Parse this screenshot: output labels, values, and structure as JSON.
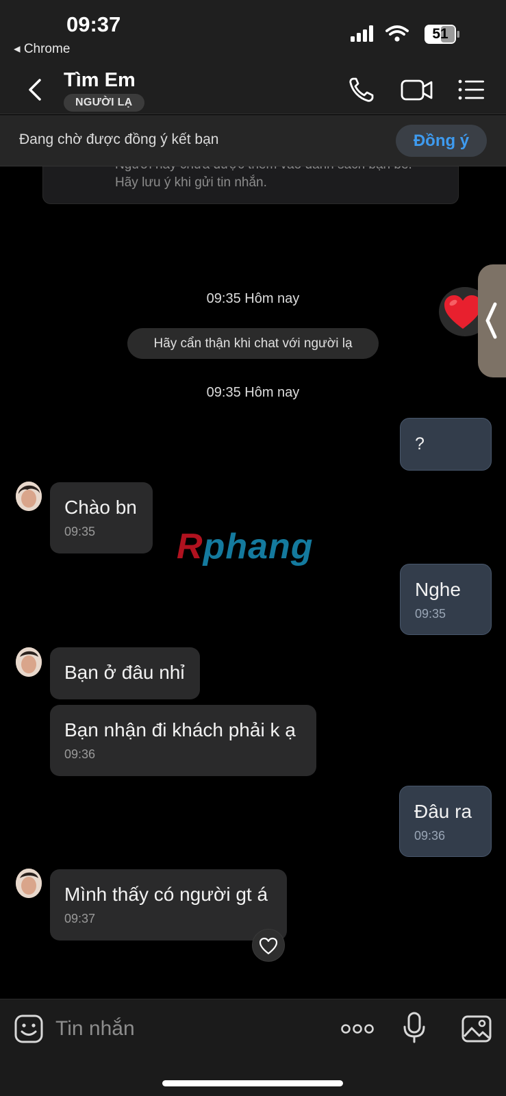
{
  "status_bar": {
    "time": "09:37",
    "back_app": "◂ Chrome",
    "battery": "51"
  },
  "header": {
    "contact_name": "Tìm Em",
    "badge": "NGƯỜI LẠ"
  },
  "friend_request": {
    "text": "Đang chờ được đồng ý kết bạn",
    "accept_label": "Đồng ý"
  },
  "notice": {
    "text": "Người này chưa được thêm vào danh sách bạn bè. Hãy lưu ý khi gửi tin nhắn."
  },
  "conversation": {
    "time_label_1": "09:35 Hôm nay",
    "system_message": "Hãy cẩn thận khi chat với người lạ",
    "time_label_2": "09:35 Hôm nay",
    "messages": [
      {
        "direction": "out",
        "text": "?",
        "time": ""
      },
      {
        "direction": "in",
        "text": "Chào bn",
        "time": "09:35"
      },
      {
        "direction": "out",
        "text": "Nghe",
        "time": "09:35"
      },
      {
        "direction": "in",
        "text": "Bạn ở đâu nhỉ",
        "time": ""
      },
      {
        "direction": "in",
        "text": "Bạn nhận đi khách phải k ạ",
        "time": "09:36"
      },
      {
        "direction": "out",
        "text": "Đâu ra",
        "time": "09:36"
      },
      {
        "direction": "in",
        "text": "Mình thấy có người gt á",
        "time": "09:37"
      }
    ]
  },
  "watermark": {
    "first": "R",
    "rest": "phang"
  },
  "composer": {
    "placeholder": "Tin nhắn"
  },
  "colors": {
    "accent": "#3e9bf0",
    "outgoing_bubble": "#333d4b",
    "incoming_bubble": "#2a2a2b",
    "reaction_heart": "#e8202e"
  }
}
